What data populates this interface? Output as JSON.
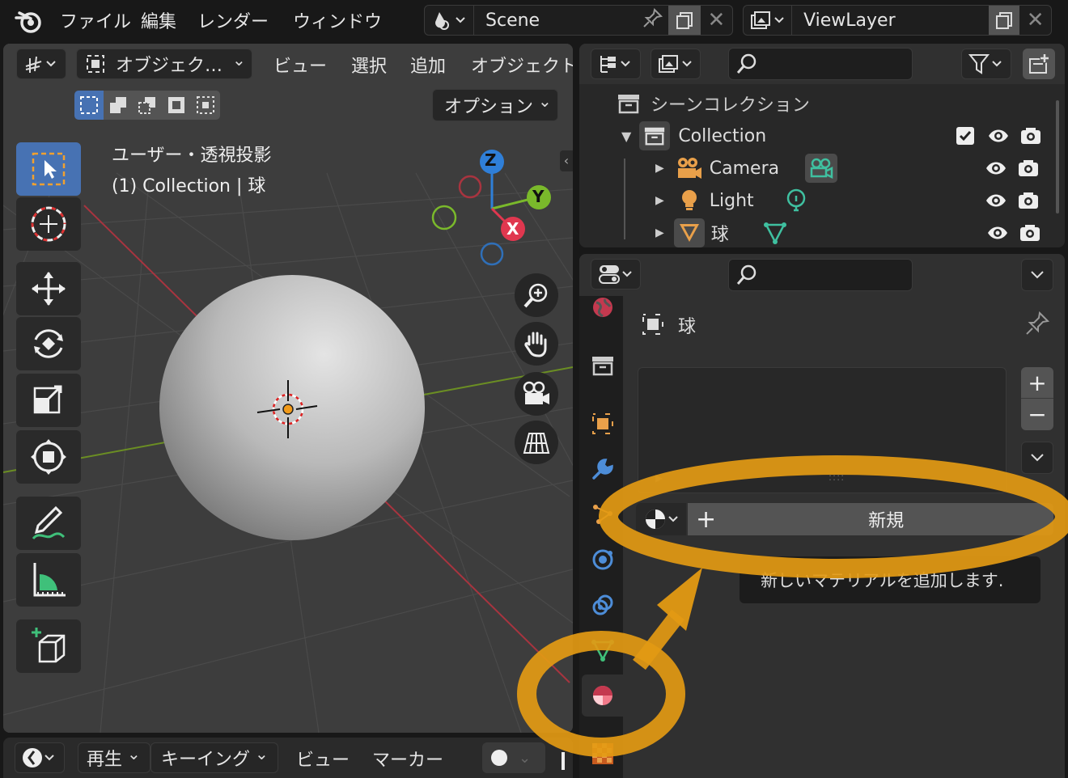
{
  "topbar": {
    "menus": [
      "ファイル",
      "編集",
      "レンダー",
      "ウィンドウ"
    ],
    "scene_name": "Scene",
    "viewlayer_name": "ViewLayer"
  },
  "viewport_header": {
    "mode_label": "オブジェク…",
    "menus": [
      "ビュー",
      "選択",
      "追加",
      "オブジェクト"
    ],
    "options_label": "オプション"
  },
  "viewport": {
    "view_name": "ユーザー・透視投影",
    "object_info": "(1) Collection | 球",
    "gizmo_axes": {
      "z": "Z",
      "y": "Y",
      "x": "X"
    }
  },
  "outliner": {
    "root_label": "シーンコレクション",
    "collection_label": "Collection",
    "items": [
      {
        "label": "Camera",
        "icon": "camera-icon"
      },
      {
        "label": "Light",
        "icon": "light-icon"
      },
      {
        "label": "球",
        "icon": "mesh-icon"
      }
    ]
  },
  "properties": {
    "object_name": "球",
    "new_button_label": "新規",
    "tooltip": "新しいマテリアルを追加します."
  },
  "timeline": {
    "menus": [
      "再生",
      "キーイング",
      "ビュー",
      "マーカー"
    ]
  },
  "colors": {
    "accent_blue": "#4772b3",
    "highlight_orange": "#e39a13",
    "axis_x": "#e0374f",
    "axis_y": "#7ab92b",
    "axis_z": "#2f7fd8"
  }
}
